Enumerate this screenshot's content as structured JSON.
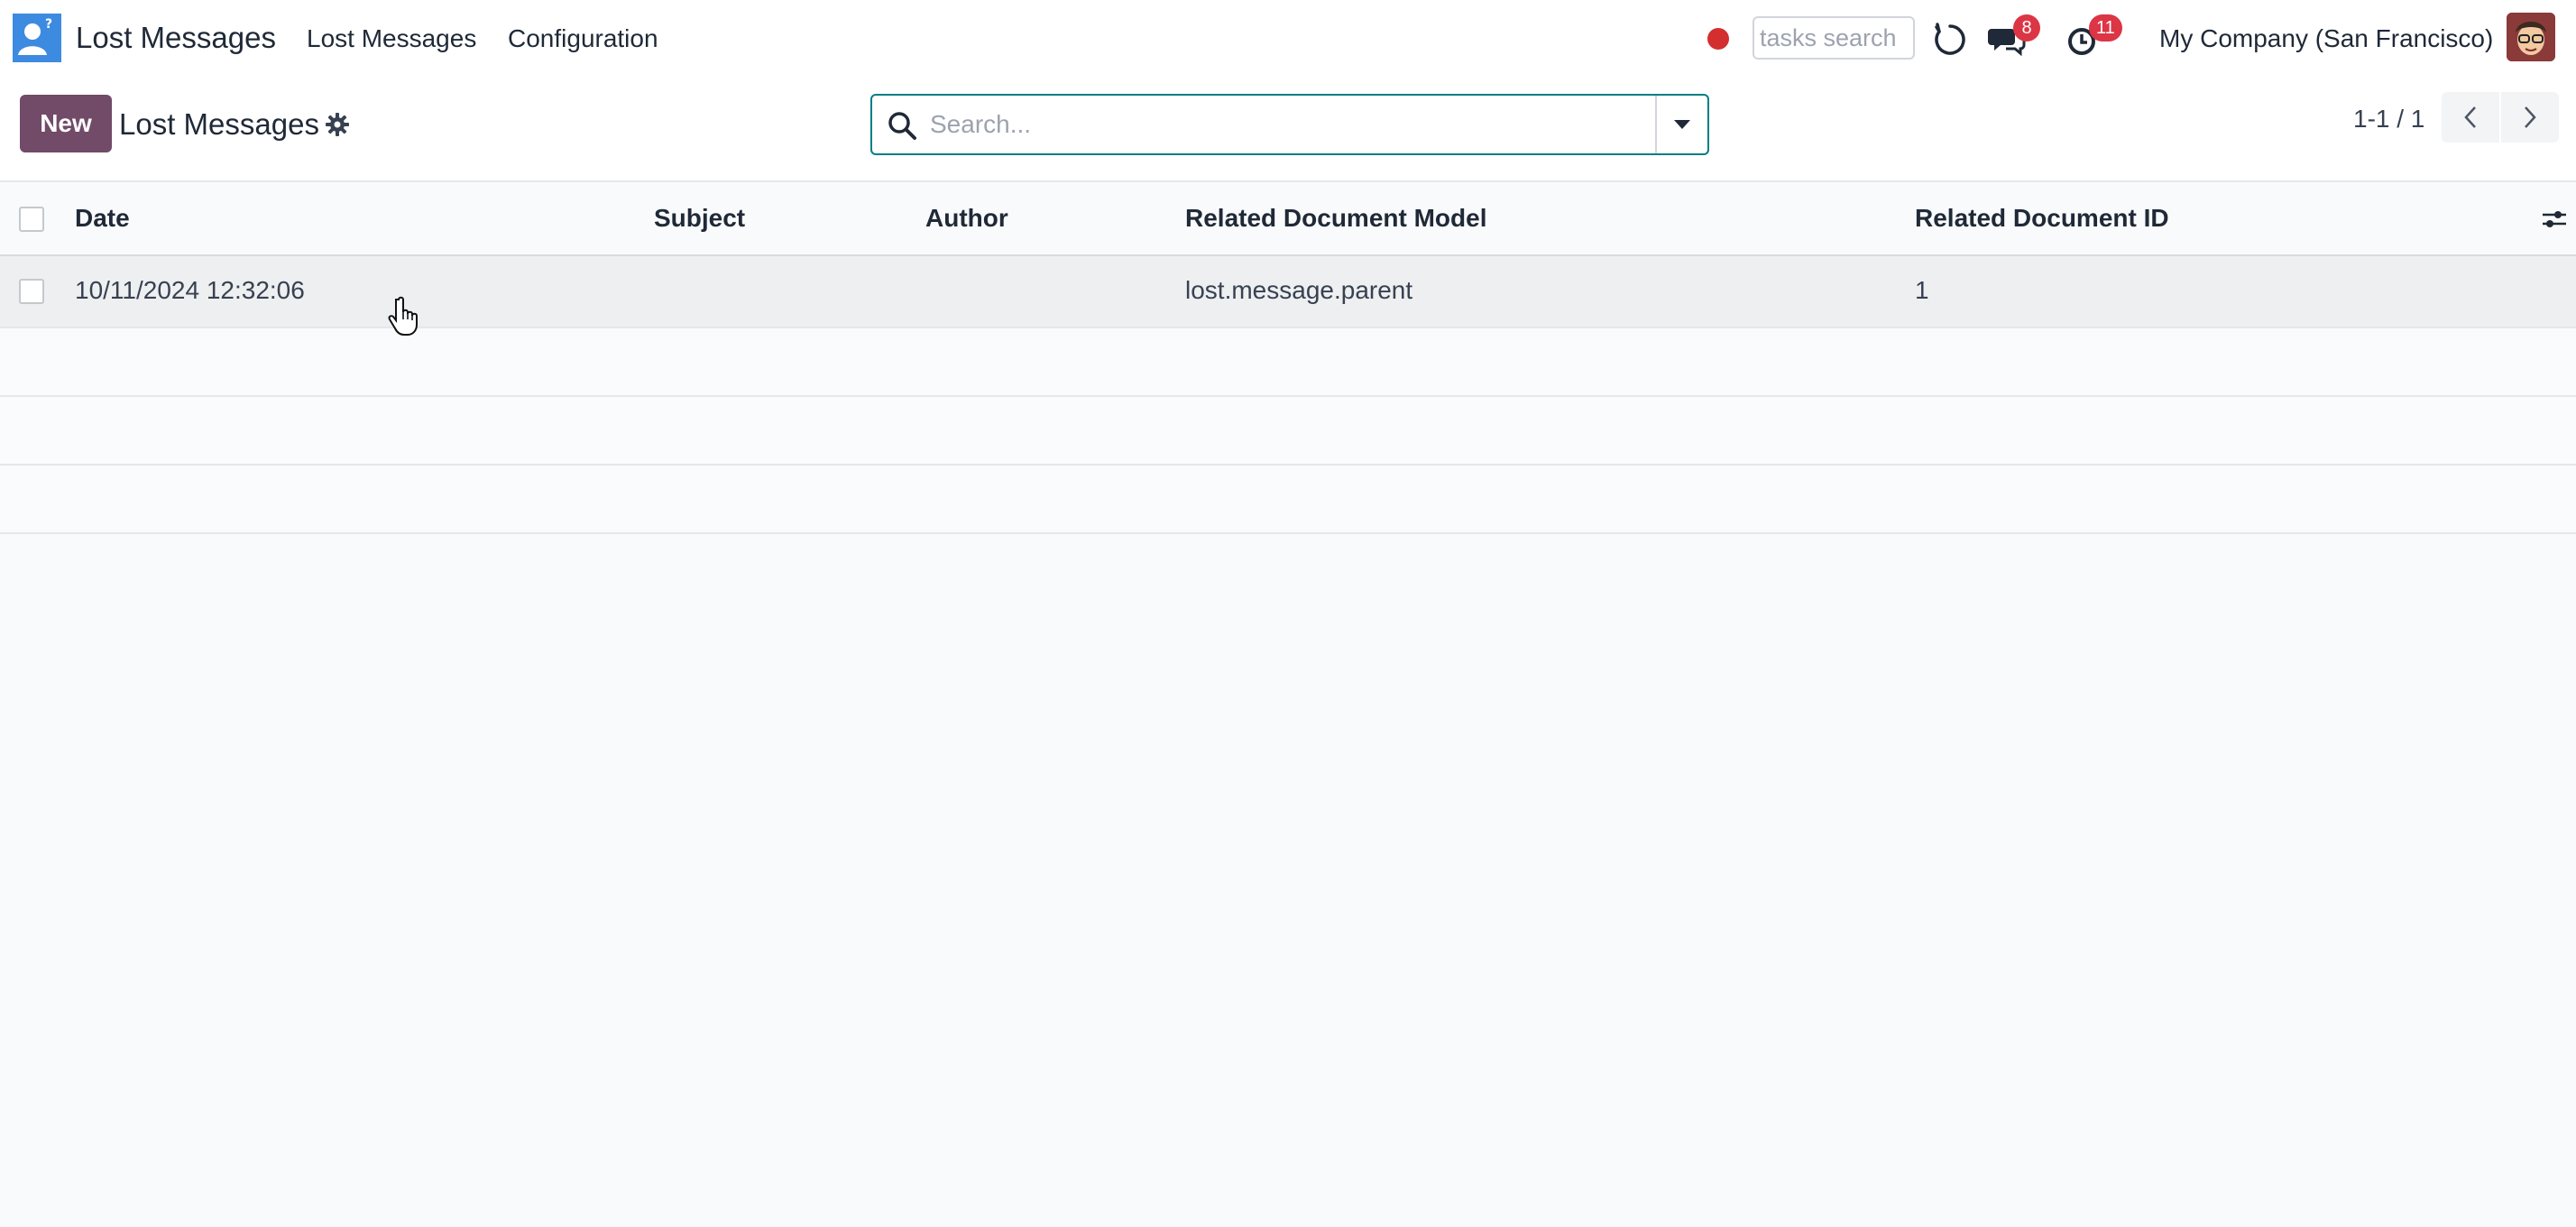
{
  "navbar": {
    "app_title": "Lost Messages",
    "menu": [
      "Lost Messages",
      "Configuration"
    ],
    "tasks_search_placeholder": "tasks search",
    "chat_badge": "8",
    "activity_badge": "11",
    "company": "My Company (San Francisco)",
    "icons": {
      "app": "app-logo-icon",
      "record": "record-dot-icon",
      "voip": "phone-icon",
      "chat": "chat-icon",
      "activity": "clock-icon"
    }
  },
  "control_panel": {
    "new_label": "New",
    "title": "Lost Messages",
    "search_placeholder": "Search...",
    "pager": "1-1 / 1"
  },
  "table": {
    "columns": [
      "Date",
      "Subject",
      "Author",
      "Related Document Model",
      "Related Document ID"
    ],
    "rows": [
      {
        "date": "10/11/2024 12:32:06",
        "subject": "",
        "author": "",
        "model": "lost.message.parent",
        "res_id": "1"
      }
    ]
  },
  "colors": {
    "primary": "#714b67",
    "accent": "#017e84",
    "badge": "#dc3545",
    "record": "#d32f2f",
    "app_logo": "#3d8be0"
  }
}
